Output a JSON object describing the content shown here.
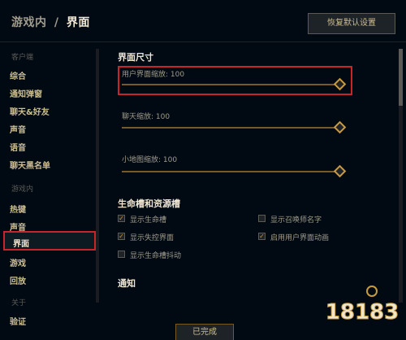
{
  "header": {
    "crumb_parent": "游戏内",
    "crumb_sep": "/",
    "crumb_current": "界面",
    "reset_label": "恢复默认设置"
  },
  "sidebar": {
    "section_client": "客户端",
    "client_items": [
      "综合",
      "通知弹窗",
      "聊天&好友",
      "声音",
      "语音",
      "聊天黑名单"
    ],
    "section_ingame": "游戏内",
    "ingame_items": [
      "热键",
      "声音",
      "界面",
      "游戏",
      "回放"
    ],
    "active_item": "界面",
    "section_about": "关于",
    "about_items": [
      "验证"
    ]
  },
  "content": {
    "ui_size_title": "界面尺寸",
    "sliders": [
      {
        "label": "用户界面缩放: 100",
        "value": 100
      },
      {
        "label": "聊天缩放: 100",
        "value": 100
      },
      {
        "label": "小地图缩放: 100",
        "value": 100
      }
    ],
    "health_title": "生命槽和资源槽",
    "checkboxes": [
      {
        "label": "显示生命槽",
        "checked": true
      },
      {
        "label": "显示召唤师名字",
        "checked": false
      },
      {
        "label": "显示失控界面",
        "checked": true
      },
      {
        "label": "启用用户界面动画",
        "checked": true
      },
      {
        "label": "显示生命槽抖动",
        "checked": false
      }
    ],
    "notify_title": "通知"
  },
  "footer": {
    "done_label": "已完成"
  },
  "watermark": {
    "text": "18183"
  },
  "colors": {
    "background": "#010a13",
    "gold": "#c89b3c",
    "highlight_red": "#c8252a",
    "text_light": "#f0e6d2"
  }
}
